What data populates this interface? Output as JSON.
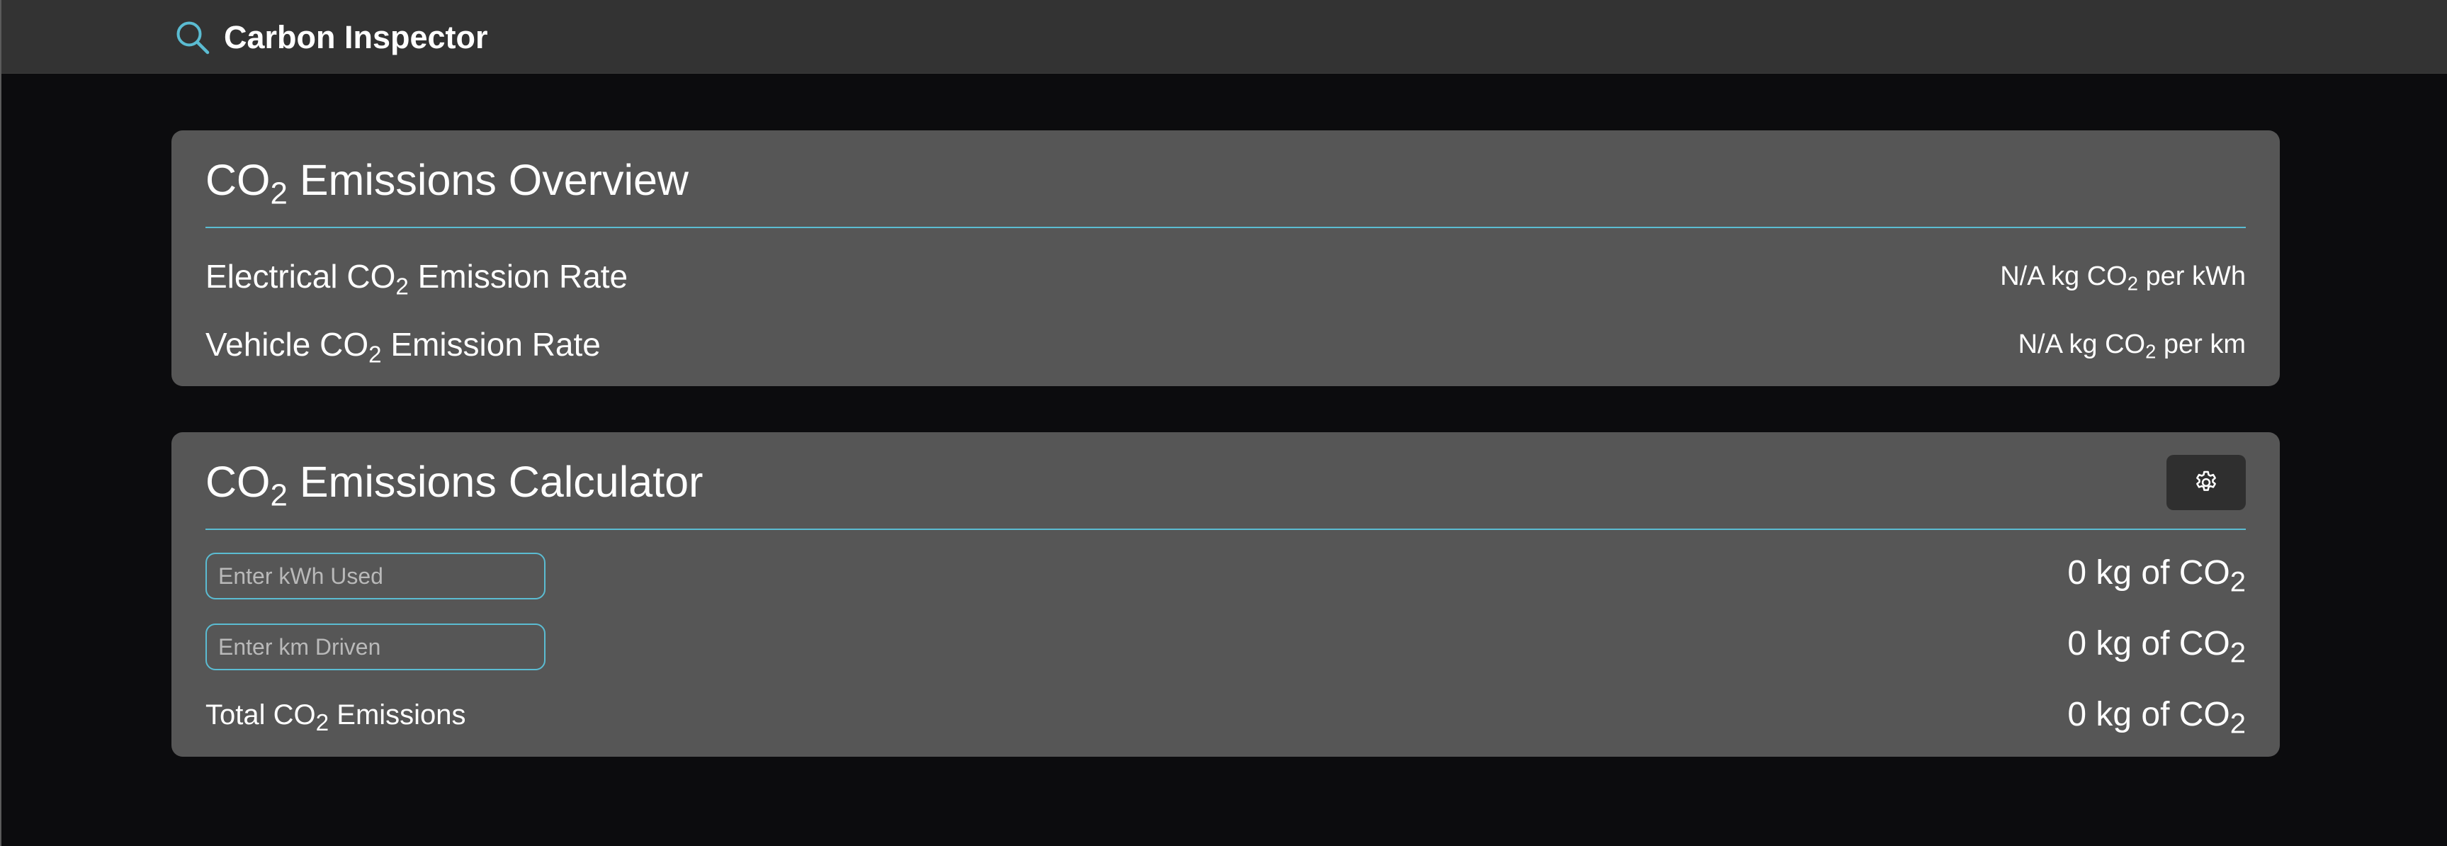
{
  "app": {
    "title": "Carbon Inspector",
    "icon": "search-icon",
    "accent_color": "#5bbcd2"
  },
  "overview": {
    "title_prefix": "CO",
    "title_sub": "2",
    "title_suffix": " Emissions Overview",
    "rows": [
      {
        "label_prefix": "Electrical CO",
        "label_sub": "2",
        "label_suffix": " Emission Rate",
        "value_prefix": "N/A kg CO",
        "value_sub": "2",
        "value_suffix": " per kWh"
      },
      {
        "label_prefix": "Vehicle CO",
        "label_sub": "2",
        "label_suffix": " Emission Rate",
        "value_prefix": "N/A kg CO",
        "value_sub": "2",
        "value_suffix": " per km"
      }
    ]
  },
  "calculator": {
    "title_prefix": "CO",
    "title_sub": "2",
    "title_suffix": " Emissions Calculator",
    "settings_icon": "gear-icon",
    "kwh_input": {
      "placeholder": "Enter kWh Used",
      "value": ""
    },
    "km_input": {
      "placeholder": "Enter km Driven",
      "value": ""
    },
    "kwh_result": {
      "prefix": "0 kg of CO",
      "sub": "2"
    },
    "km_result": {
      "prefix": "0 kg of CO",
      "sub": "2"
    },
    "total": {
      "label_prefix": "Total CO",
      "label_sub": "2",
      "label_suffix": " Emissions",
      "value_prefix": "0 kg of CO",
      "value_sub": "2"
    }
  }
}
